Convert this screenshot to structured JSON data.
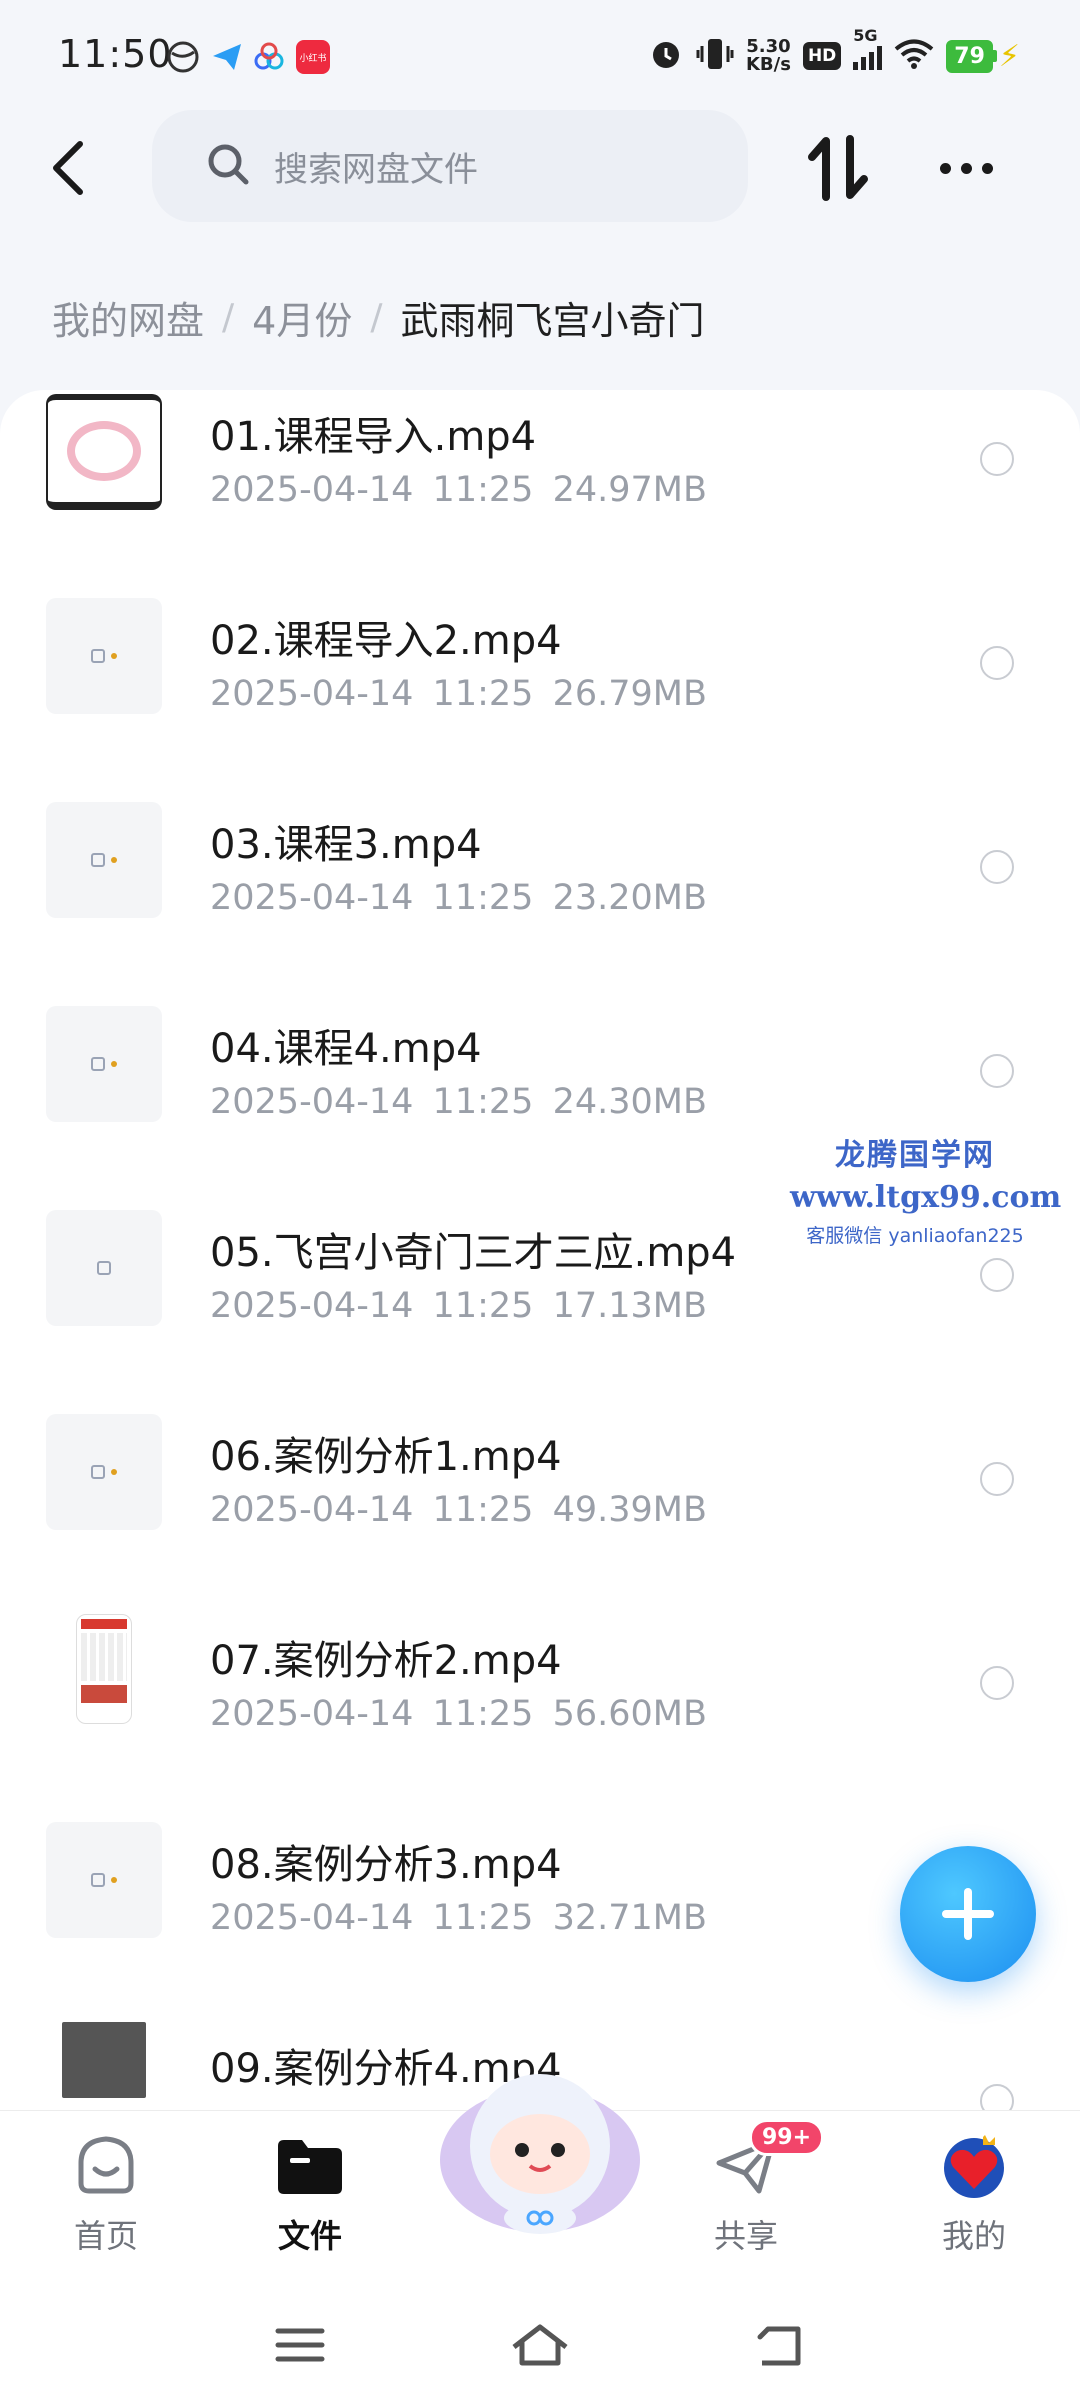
{
  "status_bar": {
    "time": "11:50",
    "net_speed_value": "5.30",
    "net_speed_unit": "KB/s",
    "hd": "HD",
    "network": "5G",
    "battery": "79",
    "app_icon_label": "小红书"
  },
  "header": {
    "search_placeholder": "搜索网盘文件"
  },
  "breadcrumb": {
    "items": [
      "我的网盘",
      "4月份",
      "武雨桐飞宫小奇门"
    ]
  },
  "files": [
    {
      "name": "01.课程导入.mp4",
      "date": "2025-04-14",
      "time": "11:25",
      "size": "24.97MB",
      "thumb": "cover"
    },
    {
      "name": "02.课程导入2.mp4",
      "date": "2025-04-14",
      "time": "11:25",
      "size": "26.79MB",
      "thumb": "mini"
    },
    {
      "name": "03.课程3.mp4",
      "date": "2025-04-14",
      "time": "11:25",
      "size": "23.20MB",
      "thumb": "mini"
    },
    {
      "name": "04.课程4.mp4",
      "date": "2025-04-14",
      "time": "11:25",
      "size": "24.30MB",
      "thumb": "mini"
    },
    {
      "name": "05.飞宫小奇门三才三应.mp4",
      "date": "2025-04-14",
      "time": "11:25",
      "size": "17.13MB",
      "thumb": "mini"
    },
    {
      "name": "06.案例分析1.mp4",
      "date": "2025-04-14",
      "time": "11:25",
      "size": "49.39MB",
      "thumb": "mini"
    },
    {
      "name": "07.案例分析2.mp4",
      "date": "2025-04-14",
      "time": "11:25",
      "size": "56.60MB",
      "thumb": "phone"
    },
    {
      "name": "08.案例分析3.mp4",
      "date": "2025-04-14",
      "time": "11:25",
      "size": "32.71MB",
      "thumb": "mini"
    },
    {
      "name": "09.案例分析4.mp4",
      "date": "",
      "time": "",
      "size": "",
      "thumb": "paper"
    }
  ],
  "watermark": {
    "line1": "龙腾国学网",
    "line2": "www.ltgx99.com",
    "line3": "客服微信 yanliaofan225"
  },
  "bottom_nav": {
    "home": "首页",
    "files": "文件",
    "share": "共享",
    "share_badge": "99+",
    "mine": "我的"
  }
}
